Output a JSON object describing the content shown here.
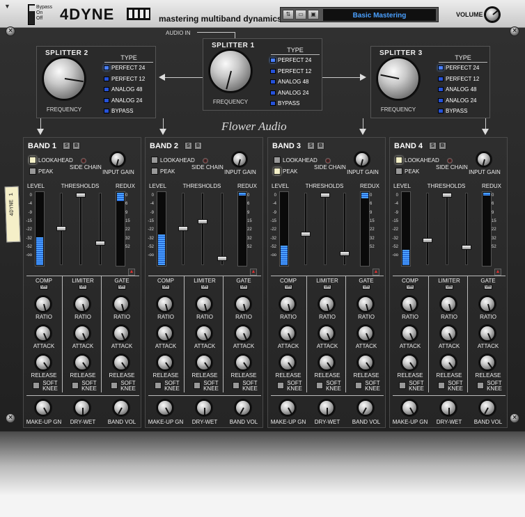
{
  "header": {
    "bypass": {
      "labels": [
        "Bypass",
        "On",
        "Off"
      ]
    },
    "brand": "4DYNE",
    "tagline": "mastering multiband dynamics",
    "preset_name": "Basic Mastering",
    "volume_label": "VOLUME",
    "audio_in_label": "AUDIO IN"
  },
  "splitters": [
    {
      "title": "SPLITTER 1",
      "knob_label": "FREQUENCY",
      "type_label": "TYPE",
      "options": [
        "PERFECT 24",
        "PERFECT 12",
        "ANALOG 48",
        "ANALOG 24",
        "BYPASS"
      ],
      "selected": "PERFECT 24",
      "knob_value": 0.55
    },
    {
      "title": "SPLITTER 2",
      "knob_label": "FREQUENCY",
      "type_label": "TYPE",
      "options": [
        "PERFECT 24",
        "PERFECT 12",
        "ANALOG 48",
        "ANALOG 24",
        "BYPASS"
      ],
      "selected": "PERFECT 24",
      "knob_value": 0.22
    },
    {
      "title": "SPLITTER 3",
      "knob_label": "FREQUENCY",
      "type_label": "TYPE",
      "options": [
        "PERFECT 24",
        "PERFECT 12",
        "ANALOG 48",
        "ANALOG 24",
        "BYPASS"
      ],
      "selected": "PERFECT 24",
      "knob_value": 0.85
    }
  ],
  "script_logo": "Flower Audio",
  "tape_label": "4DYNE 1",
  "band_labels": {
    "lookahead": "LOOKAHEAD",
    "peak": "PEAK",
    "side_chain": "SIDE CHAIN",
    "input_gain": "INPUT GAIN",
    "level": "LEVEL",
    "thresholds": "THRESHOLDS",
    "redux": "REDUX",
    "comp": "COMP",
    "limiter": "LIMITER",
    "gate": "GATE",
    "on": "ON",
    "ratio": "RATIO",
    "attack": "ATTACK",
    "release": "RELEASE",
    "soft_knee": "SOFT KNEE",
    "makeup": "MAKE-UP GN",
    "drywet": "DRY-WET",
    "bandvol": "BAND VOL",
    "solo": "S",
    "bypass": "B"
  },
  "scale_ticks": [
    "0",
    "-4",
    "-9",
    "-15",
    "-22",
    "-32",
    "-52",
    "-oo"
  ],
  "redux_ticks": [
    "0",
    "6",
    "9",
    "15",
    "22",
    "32",
    "52"
  ],
  "bands": [
    {
      "title": "BAND 1",
      "lookahead": true,
      "peak": false,
      "level": 0.38,
      "redux": 0.12,
      "thresholds": [
        0.5,
        0.0,
        0.72
      ]
    },
    {
      "title": "BAND 2",
      "lookahead": false,
      "peak": false,
      "level": 0.42,
      "redux": 0.04,
      "thresholds": [
        0.5,
        0.4,
        0.95
      ]
    },
    {
      "title": "BAND 3",
      "lookahead": false,
      "peak": true,
      "level": 0.27,
      "redux": 0.08,
      "thresholds": [
        0.58,
        0.0,
        0.88
      ]
    },
    {
      "title": "BAND 4",
      "lookahead": true,
      "peak": false,
      "level": 0.21,
      "redux": 0.04,
      "thresholds": [
        0.68,
        0.0,
        0.78
      ]
    }
  ]
}
